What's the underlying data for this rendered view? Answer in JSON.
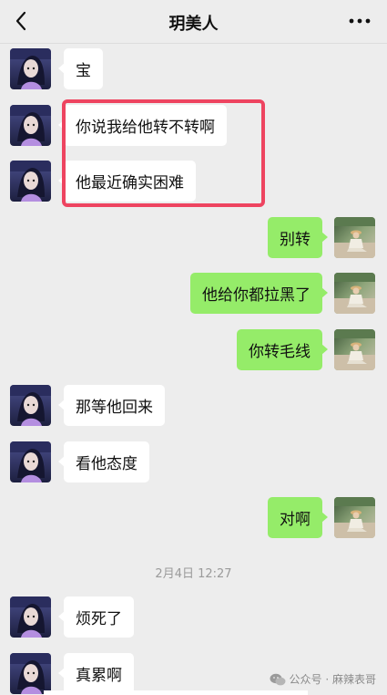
{
  "header": {
    "title": "玥美人",
    "back_icon": "chevron-left-icon",
    "more_icon": "more-dots-icon"
  },
  "colors": {
    "background": "#ededed",
    "bubble_incoming": "#ffffff",
    "bubble_outgoing": "#95ec69",
    "highlight": "#ee4460"
  },
  "messages": [
    {
      "side": "left",
      "text": "宝"
    },
    {
      "side": "left",
      "text": "你说我给他转不转啊"
    },
    {
      "side": "left",
      "text": "他最近确实困难"
    },
    {
      "side": "right",
      "text": "别转"
    },
    {
      "side": "right",
      "text": "他给你都拉黑了"
    },
    {
      "side": "right",
      "text": "你转毛线"
    },
    {
      "side": "left",
      "text": "那等他回来"
    },
    {
      "side": "left",
      "text": "看他态度"
    },
    {
      "side": "right",
      "text": "对啊"
    },
    {
      "side": "left",
      "text": "烦死了"
    },
    {
      "side": "left",
      "text": "真累啊"
    }
  ],
  "timestamp": "2月4日 12:27",
  "watermark": {
    "icon": "wechat-official-account-icon",
    "text": "公众号 · 麻辣表哥"
  }
}
